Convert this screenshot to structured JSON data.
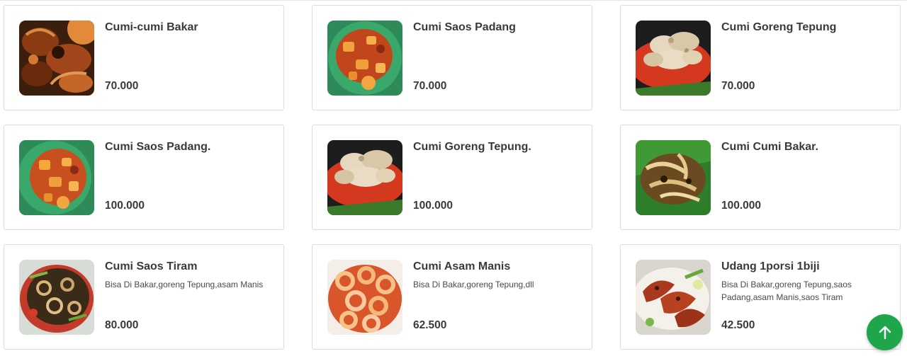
{
  "menu": {
    "items": [
      {
        "name": "Cumi-cumi Bakar",
        "description": "",
        "price": "70.000",
        "image_icon": "grilled-squid-photo"
      },
      {
        "name": "Cumi Saos Padang",
        "description": "",
        "price": "70.000",
        "image_icon": "squid-padang-sauce-photo"
      },
      {
        "name": "Cumi Goreng Tepung",
        "description": "",
        "price": "70.000",
        "image_icon": "fried-battered-squid-photo"
      },
      {
        "name": "Cumi Saos Padang.",
        "description": "",
        "price": "100.000",
        "image_icon": "squid-padang-sauce-photo"
      },
      {
        "name": "Cumi Goreng Tepung.",
        "description": "",
        "price": "100.000",
        "image_icon": "fried-battered-squid-photo"
      },
      {
        "name": "Cumi Cumi Bakar.",
        "description": "",
        "price": "100.000",
        "image_icon": "grilled-squid-leaf-photo"
      },
      {
        "name": "Cumi Saos Tiram",
        "description": "Bisa Di Bakar,goreng Tepung,asam Manis",
        "price": "80.000",
        "image_icon": "squid-oyster-sauce-photo"
      },
      {
        "name": "Cumi Asam Manis",
        "description": "Bisa Di Bakar,goreng Tepung,dll",
        "price": "62.500",
        "image_icon": "squid-sweet-sour-photo"
      },
      {
        "name": "Udang 1porsi 1biji",
        "description": "Bisa Di Bakar,goreng Tepung,saos Padang,asam Manis,saos Tiram",
        "price": "42.500",
        "image_icon": "grilled-prawn-photo"
      }
    ]
  },
  "scroll_top": {
    "icon": "arrow-up-icon",
    "color": "#1fa64a"
  },
  "colors": {
    "text": "#3a3a3a",
    "card_border": "#dcdcdc",
    "accent": "#1fa64a"
  }
}
